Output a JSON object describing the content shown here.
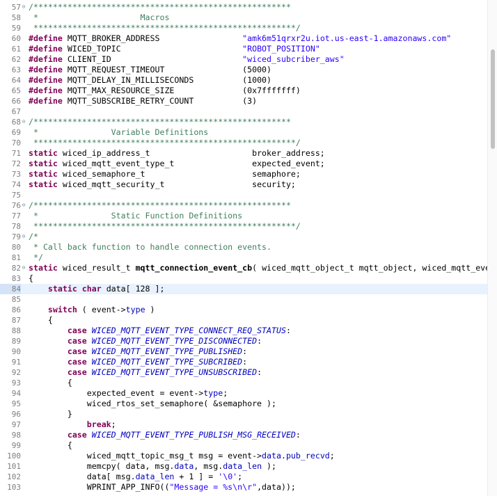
{
  "editor": {
    "current_line": "84",
    "lines": [
      {
        "n": "57",
        "fold": true,
        "tokens": [
          {
            "c": "cm",
            "t": "/*****************************************************"
          }
        ]
      },
      {
        "n": "58",
        "tokens": [
          {
            "c": "cm",
            "t": " *                     Macros"
          }
        ]
      },
      {
        "n": "59",
        "tokens": [
          {
            "c": "cm",
            "t": " ******************************************************/"
          }
        ]
      },
      {
        "n": "60",
        "tokens": [
          {
            "c": "pp",
            "t": "#define"
          },
          {
            "c": "def",
            "t": " MQTT_BROKER_ADDRESS                 "
          },
          {
            "c": "str",
            "t": "\"amk6m51qrxr2u.iot.us-east-1.amazonaws.com\""
          }
        ]
      },
      {
        "n": "61",
        "tokens": [
          {
            "c": "pp",
            "t": "#define"
          },
          {
            "c": "def",
            "t": " WICED_TOPIC                         "
          },
          {
            "c": "str",
            "t": "\"ROBOT_POSITION\""
          }
        ]
      },
      {
        "n": "62",
        "tokens": [
          {
            "c": "pp",
            "t": "#define"
          },
          {
            "c": "def",
            "t": " CLIENT_ID                           "
          },
          {
            "c": "str",
            "t": "\"wiced_subcriber_aws\""
          }
        ]
      },
      {
        "n": "63",
        "tokens": [
          {
            "c": "pp",
            "t": "#define"
          },
          {
            "c": "def",
            "t": " MQTT_REQUEST_TIMEOUT                (5000)"
          }
        ]
      },
      {
        "n": "64",
        "tokens": [
          {
            "c": "pp",
            "t": "#define"
          },
          {
            "c": "def",
            "t": " MQTT_DELAY_IN_MILLISECONDS          (1000)"
          }
        ]
      },
      {
        "n": "65",
        "tokens": [
          {
            "c": "pp",
            "t": "#define"
          },
          {
            "c": "def",
            "t": " MQTT_MAX_RESOURCE_SIZE              (0x7fffffff)"
          }
        ]
      },
      {
        "n": "66",
        "tokens": [
          {
            "c": "pp",
            "t": "#define"
          },
          {
            "c": "def",
            "t": " MQTT_SUBSCRIBE_RETRY_COUNT          (3)"
          }
        ]
      },
      {
        "n": "67",
        "tokens": []
      },
      {
        "n": "68",
        "fold": true,
        "tokens": [
          {
            "c": "cm",
            "t": "/*****************************************************"
          }
        ]
      },
      {
        "n": "69",
        "tokens": [
          {
            "c": "cm",
            "t": " *               Variable Definitions"
          }
        ]
      },
      {
        "n": "70",
        "tokens": [
          {
            "c": "cm",
            "t": " ******************************************************/"
          }
        ]
      },
      {
        "n": "71",
        "tokens": [
          {
            "c": "kw",
            "t": "static"
          },
          {
            "c": "def",
            "t": " wiced_ip_address_t                     broker_address;"
          }
        ]
      },
      {
        "n": "72",
        "tokens": [
          {
            "c": "kw",
            "t": "static"
          },
          {
            "c": "def",
            "t": " wiced_mqtt_event_type_t                expected_event;"
          }
        ]
      },
      {
        "n": "73",
        "tokens": [
          {
            "c": "kw",
            "t": "static"
          },
          {
            "c": "def",
            "t": " wiced_semaphore_t                      semaphore;"
          }
        ]
      },
      {
        "n": "74",
        "tokens": [
          {
            "c": "kw",
            "t": "static"
          },
          {
            "c": "def",
            "t": " wiced_mqtt_security_t                  security;"
          }
        ]
      },
      {
        "n": "75",
        "tokens": []
      },
      {
        "n": "76",
        "fold": true,
        "tokens": [
          {
            "c": "cm",
            "t": "/*****************************************************"
          }
        ]
      },
      {
        "n": "77",
        "tokens": [
          {
            "c": "cm",
            "t": " *               Static Function Definitions"
          }
        ]
      },
      {
        "n": "78",
        "tokens": [
          {
            "c": "cm",
            "t": " ******************************************************/"
          }
        ]
      },
      {
        "n": "79",
        "fold": true,
        "tokens": [
          {
            "c": "cm",
            "t": "/*"
          }
        ]
      },
      {
        "n": "80",
        "tokens": [
          {
            "c": "cm",
            "t": " * Call back function to handle connection events."
          }
        ]
      },
      {
        "n": "81",
        "tokens": [
          {
            "c": "cm",
            "t": " */"
          }
        ]
      },
      {
        "n": "82",
        "fold": true,
        "tokens": [
          {
            "c": "kw",
            "t": "static"
          },
          {
            "c": "def",
            "t": " wiced_result_t "
          },
          {
            "c": "fn",
            "t": "mqtt_connection_event_cb"
          },
          {
            "c": "def",
            "t": "( wiced_mqtt_object_t mqtt_object, wiced_mqtt_eve"
          }
        ]
      },
      {
        "n": "83",
        "tokens": [
          {
            "c": "def",
            "t": "{"
          }
        ]
      },
      {
        "n": "84",
        "tokens": [
          {
            "c": "def",
            "t": "    "
          },
          {
            "c": "kw",
            "t": "static"
          },
          {
            "c": "def",
            "t": " "
          },
          {
            "c": "kw",
            "t": "char"
          },
          {
            "c": "def",
            "t": " data[ 128 ];"
          }
        ]
      },
      {
        "n": "85",
        "tokens": []
      },
      {
        "n": "86",
        "tokens": [
          {
            "c": "def",
            "t": "    "
          },
          {
            "c": "kw",
            "t": "switch"
          },
          {
            "c": "def",
            "t": " ( event->"
          },
          {
            "c": "fld",
            "t": "type"
          },
          {
            "c": "def",
            "t": " )"
          }
        ]
      },
      {
        "n": "87",
        "tokens": [
          {
            "c": "def",
            "t": "    {"
          }
        ]
      },
      {
        "n": "88",
        "tokens": [
          {
            "c": "def",
            "t": "        "
          },
          {
            "c": "kw",
            "t": "case"
          },
          {
            "c": "def",
            "t": " "
          },
          {
            "c": "enum",
            "t": "WICED_MQTT_EVENT_TYPE_CONNECT_REQ_STATUS"
          },
          {
            "c": "def",
            "t": ":"
          }
        ]
      },
      {
        "n": "89",
        "tokens": [
          {
            "c": "def",
            "t": "        "
          },
          {
            "c": "kw",
            "t": "case"
          },
          {
            "c": "def",
            "t": " "
          },
          {
            "c": "enum",
            "t": "WICED_MQTT_EVENT_TYPE_DISCONNECTED"
          },
          {
            "c": "def",
            "t": ":"
          }
        ]
      },
      {
        "n": "90",
        "tokens": [
          {
            "c": "def",
            "t": "        "
          },
          {
            "c": "kw",
            "t": "case"
          },
          {
            "c": "def",
            "t": " "
          },
          {
            "c": "enum",
            "t": "WICED_MQTT_EVENT_TYPE_PUBLISHED"
          },
          {
            "c": "def",
            "t": ":"
          }
        ]
      },
      {
        "n": "91",
        "tokens": [
          {
            "c": "def",
            "t": "        "
          },
          {
            "c": "kw",
            "t": "case"
          },
          {
            "c": "def",
            "t": " "
          },
          {
            "c": "enum",
            "t": "WICED_MQTT_EVENT_TYPE_SUBCRIBED"
          },
          {
            "c": "def",
            "t": ":"
          }
        ]
      },
      {
        "n": "92",
        "tokens": [
          {
            "c": "def",
            "t": "        "
          },
          {
            "c": "kw",
            "t": "case"
          },
          {
            "c": "def",
            "t": " "
          },
          {
            "c": "enum",
            "t": "WICED_MQTT_EVENT_TYPE_UNSUBSCRIBED"
          },
          {
            "c": "def",
            "t": ":"
          }
        ]
      },
      {
        "n": "93",
        "tokens": [
          {
            "c": "def",
            "t": "        {"
          }
        ]
      },
      {
        "n": "94",
        "tokens": [
          {
            "c": "def",
            "t": "            expected_event = event->"
          },
          {
            "c": "fld",
            "t": "type"
          },
          {
            "c": "def",
            "t": ";"
          }
        ]
      },
      {
        "n": "95",
        "tokens": [
          {
            "c": "def",
            "t": "            wiced_rtos_set_semaphore( &semaphore );"
          }
        ]
      },
      {
        "n": "96",
        "tokens": [
          {
            "c": "def",
            "t": "        }"
          }
        ]
      },
      {
        "n": "97",
        "tokens": [
          {
            "c": "def",
            "t": "            "
          },
          {
            "c": "kw",
            "t": "break"
          },
          {
            "c": "def",
            "t": ";"
          }
        ]
      },
      {
        "n": "98",
        "tokens": [
          {
            "c": "def",
            "t": "        "
          },
          {
            "c": "kw",
            "t": "case"
          },
          {
            "c": "def",
            "t": " "
          },
          {
            "c": "enum",
            "t": "WICED_MQTT_EVENT_TYPE_PUBLISH_MSG_RECEIVED"
          },
          {
            "c": "def",
            "t": ":"
          }
        ]
      },
      {
        "n": "99",
        "tokens": [
          {
            "c": "def",
            "t": "        {"
          }
        ]
      },
      {
        "n": "100",
        "tokens": [
          {
            "c": "def",
            "t": "            wiced_mqtt_topic_msg_t msg = event->"
          },
          {
            "c": "fld",
            "t": "data"
          },
          {
            "c": "def",
            "t": "."
          },
          {
            "c": "fld",
            "t": "pub_recvd"
          },
          {
            "c": "def",
            "t": ";"
          }
        ]
      },
      {
        "n": "101",
        "tokens": [
          {
            "c": "def",
            "t": "            memcpy( data, msg."
          },
          {
            "c": "fld",
            "t": "data"
          },
          {
            "c": "def",
            "t": ", msg."
          },
          {
            "c": "fld",
            "t": "data_len"
          },
          {
            "c": "def",
            "t": " );"
          }
        ]
      },
      {
        "n": "102",
        "tokens": [
          {
            "c": "def",
            "t": "            data[ msg."
          },
          {
            "c": "fld",
            "t": "data_len"
          },
          {
            "c": "def",
            "t": " + 1 ] = "
          },
          {
            "c": "str",
            "t": "'\\0'"
          },
          {
            "c": "def",
            "t": ";"
          }
        ]
      },
      {
        "n": "103",
        "tokens": [
          {
            "c": "def",
            "t": "            WPRINT_APP_INFO(("
          },
          {
            "c": "str",
            "t": "\"Message = %s\\n\\r\""
          },
          {
            "c": "def",
            "t": ",data));"
          }
        ]
      }
    ]
  },
  "scrollbar": {
    "position": 0.1,
    "visible_fraction": 0.2
  }
}
